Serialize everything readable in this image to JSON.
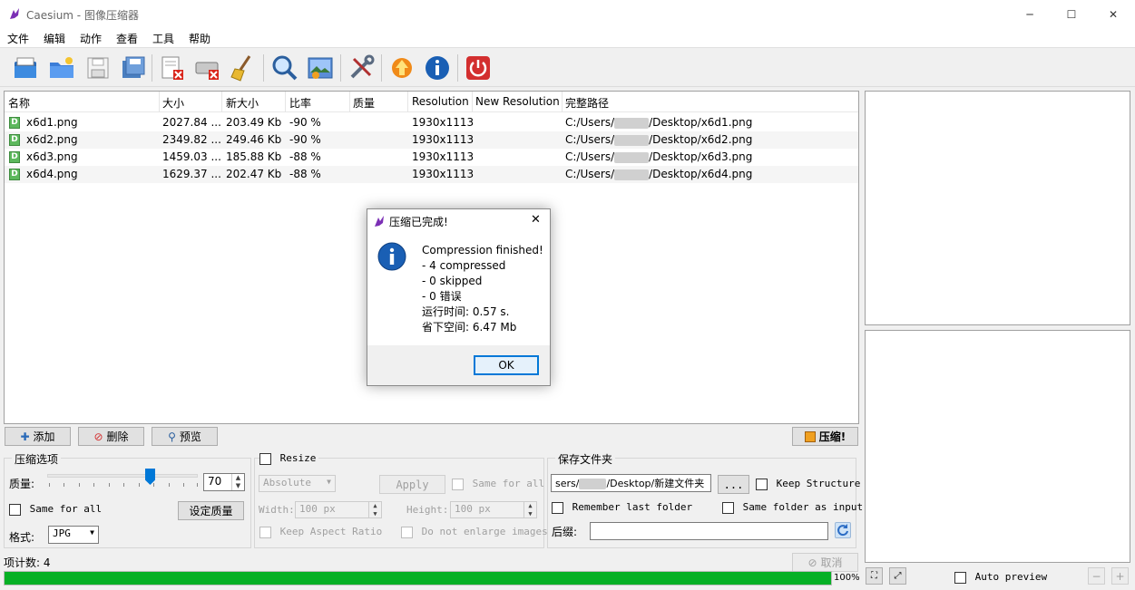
{
  "window": {
    "title": "Caesium - 图像压缩器",
    "minimize": "─",
    "maximize": "☐",
    "close": "✕"
  },
  "menu": [
    "文件",
    "编辑",
    "动作",
    "查看",
    "工具",
    "帮助"
  ],
  "toolbar": {
    "icons": [
      "open-files-icon",
      "open-folder-icon",
      "save-icon",
      "save-all-icon",
      "remove-item-icon",
      "clear-list-icon",
      "clean-icon",
      "zoom-icon",
      "preview-image-icon",
      "settings-tools-icon",
      "update-icon",
      "info-icon",
      "exit-icon"
    ]
  },
  "table": {
    "columns": [
      "名称",
      "大小",
      "新大小",
      "比率",
      "质量",
      "Resolution",
      "New Resolution",
      "完整路径"
    ],
    "rows": [
      {
        "name": "x6d1.png",
        "size": "2027.84 ...",
        "new_size": "203.49 Kb",
        "ratio": "-90 %",
        "quality": "",
        "resolution": "1930x1113",
        "new_resolution": "",
        "path_prefix": "C:/Users/",
        "path_suffix": "/Desktop/x6d1.png"
      },
      {
        "name": "x6d2.png",
        "size": "2349.82 ...",
        "new_size": "249.46 Kb",
        "ratio": "-90 %",
        "quality": "",
        "resolution": "1930x1113",
        "new_resolution": "",
        "path_prefix": "C:/Users/",
        "path_suffix": "/Desktop/x6d2.png"
      },
      {
        "name": "x6d3.png",
        "size": "1459.03 ...",
        "new_size": "185.88 Kb",
        "ratio": "-88 %",
        "quality": "",
        "resolution": "1930x1113",
        "new_resolution": "",
        "path_prefix": "C:/Users/",
        "path_suffix": "/Desktop/x6d3.png"
      },
      {
        "name": "x6d4.png",
        "size": "1629.37 ...",
        "new_size": "202.47 Kb",
        "ratio": "-88 %",
        "quality": "",
        "resolution": "1930x1113",
        "new_resolution": "",
        "path_prefix": "C:/Users/",
        "path_suffix": "/Desktop/x6d4.png"
      }
    ],
    "file_badge": "D"
  },
  "buttons": {
    "add": "添加",
    "delete": "删除",
    "preview": "预览",
    "compress": "压缩!"
  },
  "compression": {
    "title": "压缩选项",
    "quality_label": "质量:",
    "quality_value": "70",
    "quality_level": 70,
    "same_for_all": "Same for all",
    "set_quality": "设定质量",
    "format_label": "格式:",
    "format_value": "JPG"
  },
  "resize": {
    "title": "Resize",
    "mode": "Absolute",
    "apply": "Apply",
    "same_for_all": "Same for all",
    "width_label": "Width:",
    "width_value": "100 px",
    "height_label": "Height:",
    "height_value": "100 px",
    "keep_aspect": "Keep Aspect Ratio",
    "no_enlarge": "Do not enlarge images"
  },
  "output": {
    "title": "保存文件夹",
    "folder_prefix": "sers/",
    "folder_suffix": "/Desktop/新建文件夹",
    "browse": "...",
    "keep_structure": "Keep Structure",
    "remember_last": "Remember last folder",
    "same_folder": "Same folder as input",
    "suffix_label": "后缀:",
    "suffix_value": ""
  },
  "status": {
    "item_count": "项计数: 4",
    "cancel": "取消",
    "progress_text": "100%",
    "progress_percent": 100,
    "auto_preview": "Auto preview"
  },
  "dialog": {
    "title": "压缩已完成!",
    "lines": [
      "Compression finished!",
      "- 4 compressed",
      "- 0 skipped",
      "- 0 错误",
      "运行时间: 0.57 s.",
      "省下空间: 6.47 Mb"
    ],
    "ok": "OK",
    "close": "✕"
  },
  "colors": {
    "accent": "#0078d7",
    "progress": "#06b025",
    "info_icon": "#1a5fb4"
  }
}
